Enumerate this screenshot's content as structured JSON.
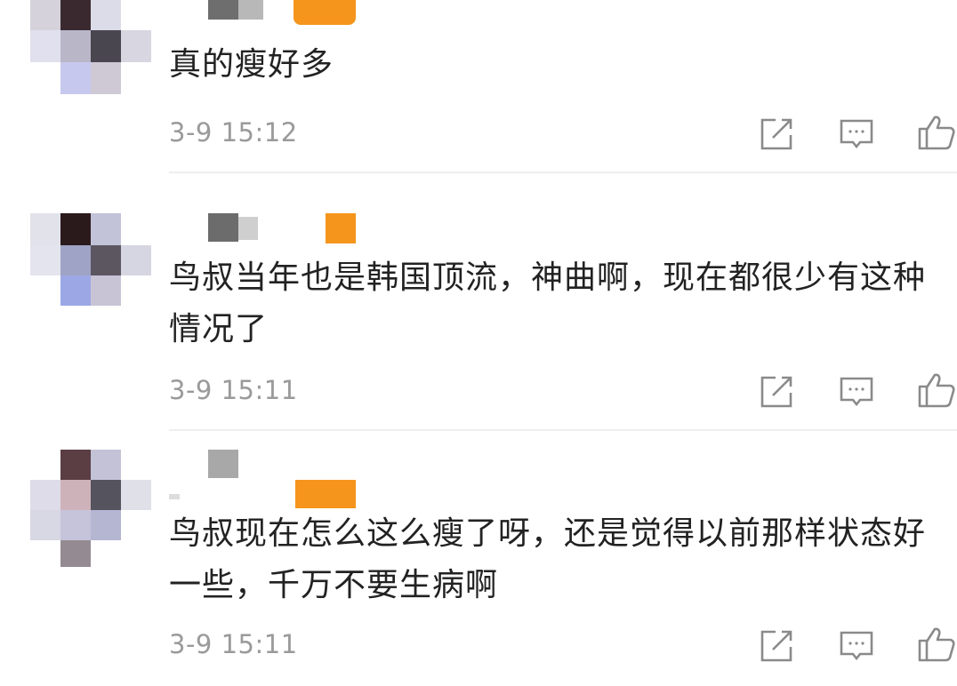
{
  "comments": [
    {
      "text": "真的瘦好多",
      "time": "3-9 15:12"
    },
    {
      "text": "鸟叔当年也是韩国顶流，神曲啊，现在都很少有这种情况了",
      "time": "3-9 15:11"
    },
    {
      "text": "鸟叔现在怎么这么瘦了呀，还是觉得以前那样状态好一些，千万不要生病啊",
      "time": "3-9 15:11"
    }
  ],
  "icons": {
    "share": "share-icon",
    "reply": "comment-icon",
    "like": "thumbs-up-icon"
  },
  "colors": {
    "text": "#222222",
    "time": "#9a9a9a",
    "icon": "#8a8a8a",
    "badge": "#f5951c",
    "divider": "#eeeeee"
  }
}
